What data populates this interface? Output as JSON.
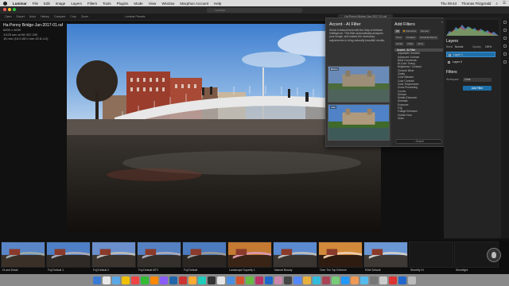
{
  "menubar": {
    "app": "Luminar",
    "items": [
      "File",
      "Edit",
      "Image",
      "Layers",
      "Filters",
      "Tools",
      "Plugins",
      "Mode",
      "View",
      "Window",
      "Macphun Account",
      "Help"
    ],
    "clock": "Thu 09:44",
    "user": "Thomas Fitzgerald"
  },
  "window": {
    "title_field": "Luminar",
    "doc_field_left": "Luminar Presets",
    "doc_field_right": "Ha-Penny-Bridge-Jan-2017-01.raf",
    "toolbar": [
      "Open",
      "Export",
      "Undo",
      "History",
      "Compare",
      "Crop",
      "Zoom"
    ],
    "active_tab": "Ha-Penny-Bridge-Jan-2017-01.raf"
  },
  "file_info": {
    "name": "Ha-Penny Bridge-Jan-2017-01.raf",
    "line1": "6000 x 4000",
    "line2": "1/125 sec at f/8    ISO 200",
    "line3": "16 mm (16.0-55.0 mm f/2.8-4.0)"
  },
  "add_filters": {
    "title": "Add Filters",
    "desc_title": "Accent - AI Filter",
    "desc_text": "Smart enhancement with the help of Artificial Intelligence. This filter automatically analyzes your image, and makes the necessary adjustments to bring naturally beautiful results.",
    "before_label": "Before",
    "after_label": "After",
    "categories_row1": [
      "All",
      "Favorites",
      "Recent"
    ],
    "categories_row2": [
      "Tone",
      "Creative",
      "Detail Enhance"
    ],
    "categories_row3": [
      "Detail",
      "Utility",
      "Mine"
    ],
    "list_header": "Accent - AI Filter",
    "filters": [
      "Adjustable Gradient",
      "Advanced Contrast",
      "B&W Conversion",
      "Bi-Color Toning",
      "Brightness / Contrast",
      "Channel Mixer",
      "Clarity",
      "Color Balance",
      "Color Contrast",
      "Color Temperature",
      "Cross Processing",
      "Curves",
      "Dehaze",
      "Details Enhancer",
      "Dramatic",
      "Exposure",
      "Fog",
      "Foliage Enhancer",
      "Golden Hour",
      "Grain"
    ],
    "search_placeholder": "Search"
  },
  "right_panel": {
    "layers_title": "Layers",
    "blend_label": "Blend",
    "blend_value": "Normal",
    "opacity_label": "Opacity",
    "opacity_value": "100%",
    "layers": [
      "Layer 1",
      "Layer 0"
    ],
    "filters_title": "Filters",
    "workspace_label": "Workspace",
    "workspace_value": "Clear",
    "add_filter_button": "Add Filter"
  },
  "presets": [
    "Hi and Detail",
    "Fuji Default 1",
    "Fuji Default 2",
    "Fuji Default MT2",
    "Fuji Default",
    "Landscape Superfly 1",
    "Natural Beauty",
    "Over The Top Extreme",
    "RAW Default",
    "Streetify 01",
    "Streetlight"
  ],
  "colors": {
    "accent": "#1d6ea8",
    "selected_layer": "#1f6fa8",
    "filter_dot": "#f5a000"
  }
}
